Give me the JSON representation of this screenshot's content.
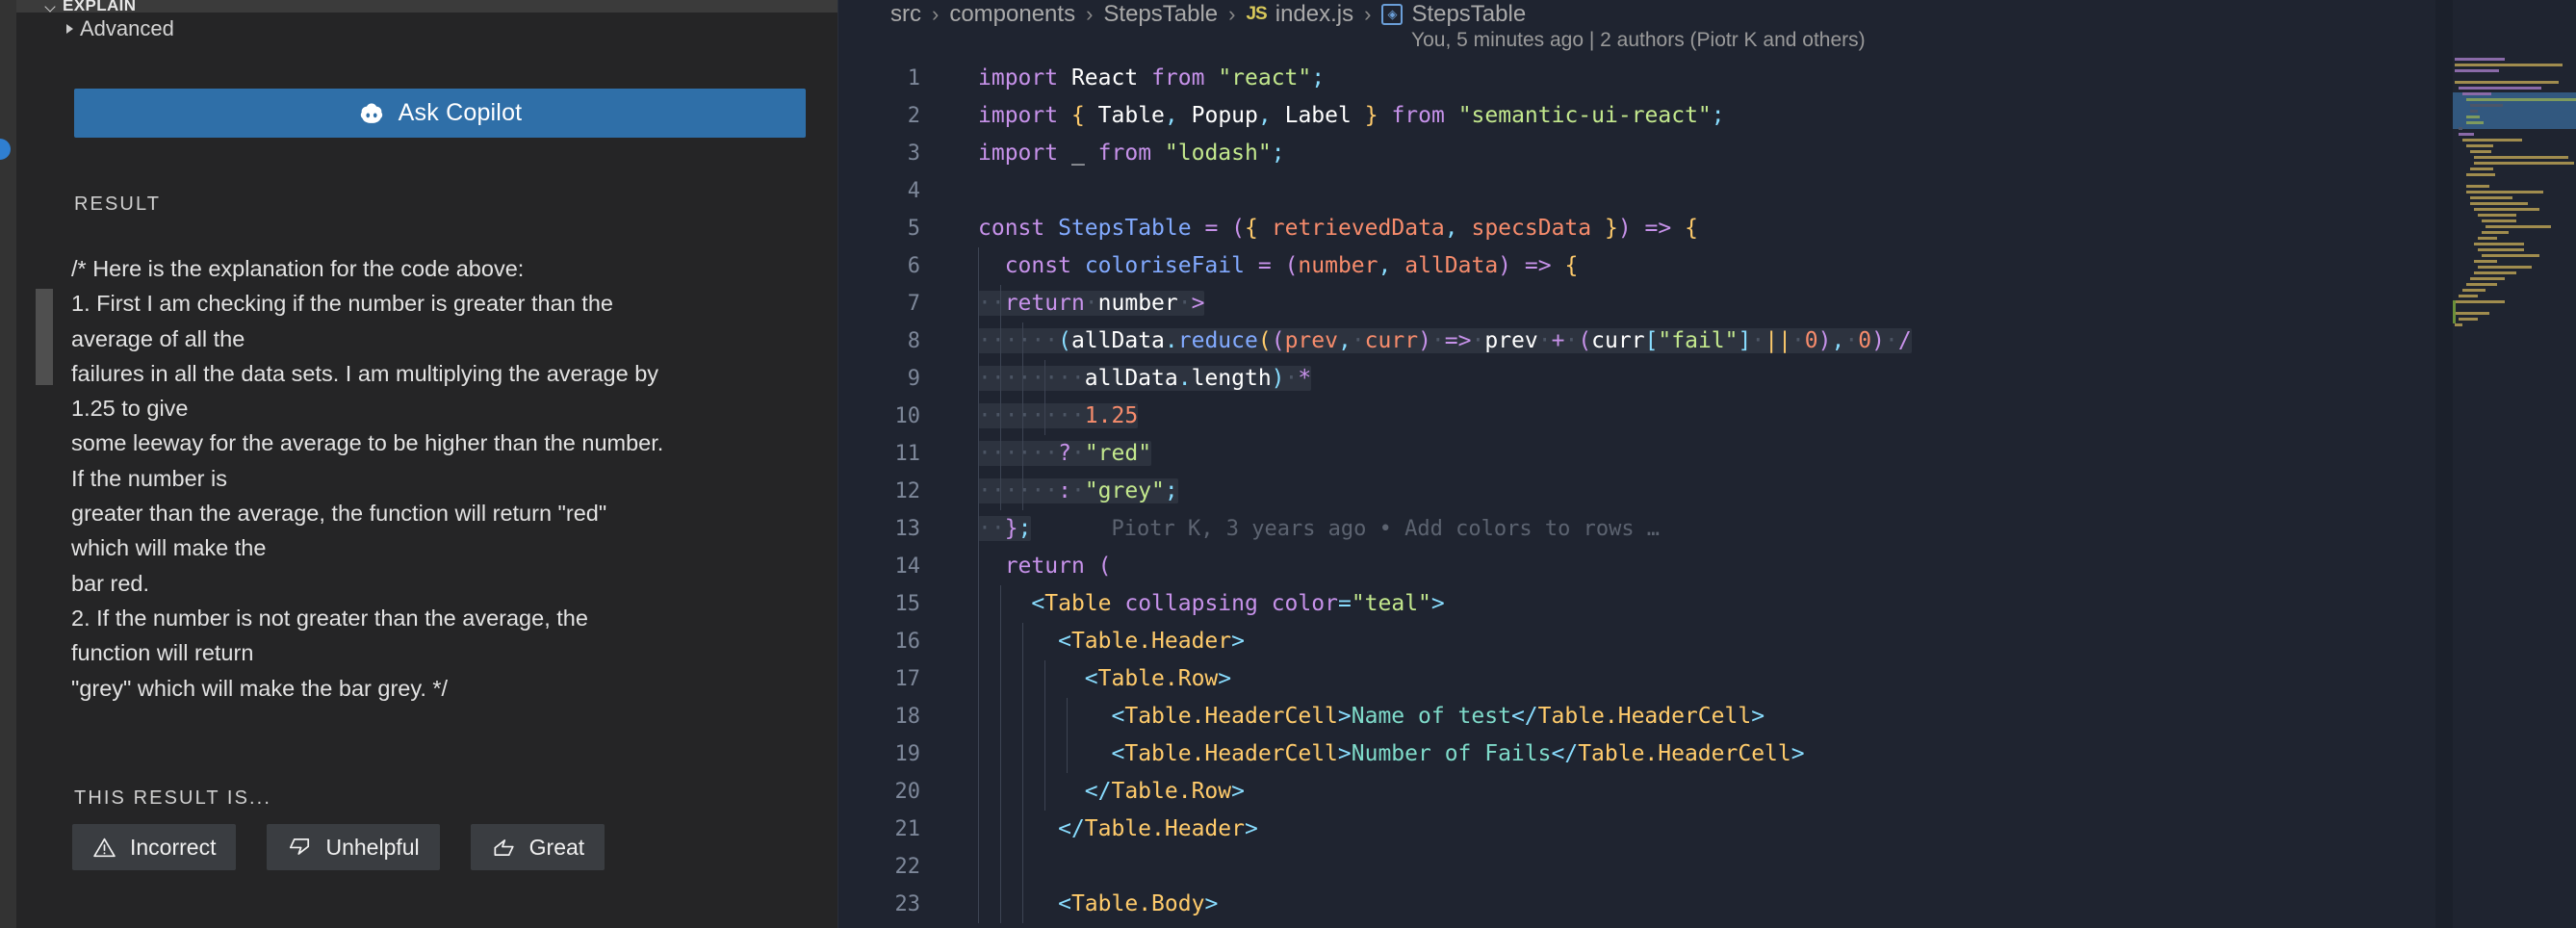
{
  "sidebar": {
    "panel_title": "EXPLAIN",
    "advanced_label": "Advanced",
    "ask_copilot_label": "Ask Copilot",
    "result_label": "RESULT",
    "feedback_label": "THIS RESULT IS...",
    "result_text": "/* Here is the explanation for the code above:\n1. First I am checking if the number is greater than the\naverage of all the\nfailures in all the data sets. I am multiplying the average by\n1.25 to give\nsome leeway for the average to be higher than the number.\nIf the number is\ngreater than the average, the function will return \"red\"\nwhich will make the\nbar red.\n2. If the number is not greater than the average, the\nfunction will return\n\"grey\" which will make the bar grey. */",
    "feedback_buttons": [
      {
        "label": "Incorrect",
        "icon": "warning-triangle-icon"
      },
      {
        "label": "Unhelpful",
        "icon": "thumbs-down-icon"
      },
      {
        "label": "Great",
        "icon": "thumbs-up-icon"
      }
    ],
    "accent_color": "#2f6fa8",
    "background_color": "#252526"
  },
  "editor": {
    "breadcrumb": {
      "items": [
        "src",
        "components",
        "StepsTable",
        "index.js",
        "StepsTable"
      ],
      "file_icon": "js-file-icon",
      "symbol_icon": "symbol-class-icon",
      "separator": "›"
    },
    "blame_header": "You, 5 minutes ago | 2 authors (Piotr K and others)",
    "inline_blame": "Piotr K, 3 years ago • Add colors to rows …",
    "background_color": "#1f2430",
    "selection_color": "#2d333f",
    "lines": [
      {
        "num": "1",
        "text": "import React from \"react\";"
      },
      {
        "num": "2",
        "text": "import { Table, Popup, Label } from \"semantic-ui-react\";"
      },
      {
        "num": "3",
        "text": "import _ from \"lodash\";"
      },
      {
        "num": "4",
        "text": ""
      },
      {
        "num": "5",
        "text": "const StepsTable = ({ retrievedData, specsData }) => {"
      },
      {
        "num": "6",
        "text": "  const coloriseFail = (number, allData) => {"
      },
      {
        "num": "7",
        "text": "    return number >"
      },
      {
        "num": "8",
        "text": "      (allData.reduce((prev, curr) => prev + (curr[\"fail\"] || 0), 0) /"
      },
      {
        "num": "9",
        "text": "        allData.length) *"
      },
      {
        "num": "10",
        "text": "        1.25"
      },
      {
        "num": "11",
        "text": "      ? \"red\""
      },
      {
        "num": "12",
        "text": "      : \"grey\";"
      },
      {
        "num": "13",
        "text": "  };"
      },
      {
        "num": "14",
        "text": "  return ("
      },
      {
        "num": "15",
        "text": "    <Table collapsing color=\"teal\">"
      },
      {
        "num": "16",
        "text": "      <Table.Header>"
      },
      {
        "num": "17",
        "text": "        <Table.Row>"
      },
      {
        "num": "18",
        "text": "          <Table.HeaderCell>Name of test</Table.HeaderCell>"
      },
      {
        "num": "19",
        "text": "          <Table.HeaderCell>Number of Fails</Table.HeaderCell>"
      },
      {
        "num": "20",
        "text": "        </Table.Row>"
      },
      {
        "num": "21",
        "text": "      </Table.Header>"
      },
      {
        "num": "22",
        "text": ""
      },
      {
        "num": "23",
        "text": "      <Table.Body>"
      }
    ]
  }
}
